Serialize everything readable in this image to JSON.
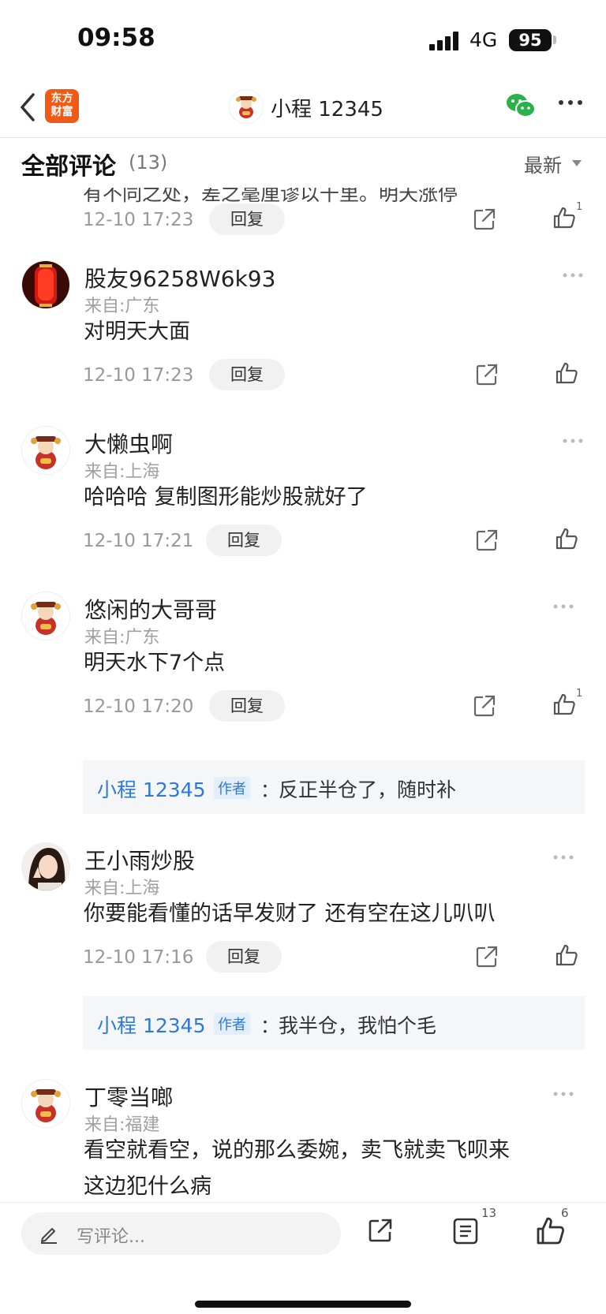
{
  "status": {
    "time": "09:58",
    "network": "4G",
    "battery": "95"
  },
  "nav": {
    "app_logo_line1": "东方",
    "app_logo_line2": "财富",
    "title": "小程 12345"
  },
  "header": {
    "title": "全部评论",
    "count": "(13)",
    "sort": "最新"
  },
  "partial_text": "有不同之处，差之毫厘谬以千里。明天涨停",
  "top_meta": {
    "time": "12-10 17:23",
    "reply": "回复",
    "likes": "1"
  },
  "comments": [
    {
      "user": "股友96258W6k93",
      "location": "来自:广东",
      "content": "对明天大面",
      "time": "12-10 17:23",
      "reply": "回复",
      "likes": ""
    },
    {
      "user": "大懒虫啊",
      "location": "来自:上海",
      "content": "哈哈哈  复制图形能炒股就好了",
      "time": "12-10 17:21",
      "reply": "回复",
      "likes": ""
    },
    {
      "user": "悠闲的大哥哥",
      "location": "来自:广东",
      "content": "明天水下7个点",
      "time": "12-10 17:20",
      "reply": "回复",
      "likes": "1",
      "sub_reply": {
        "name": "小程 12345",
        "tag": "作者",
        "colon": "：",
        "text": "反正半仓了，随时补"
      }
    },
    {
      "user": "王小雨炒股",
      "location": "来自:上海",
      "content": "你要能看懂的话早发财了 还有空在这儿叭叭",
      "time": "12-10 17:16",
      "reply": "回复",
      "likes": "",
      "sub_reply": {
        "name": "小程 12345",
        "tag": "作者",
        "colon": "：",
        "text": "我半仓，我怕个毛"
      }
    },
    {
      "user": "丁零当啷",
      "location": "来自:福建",
      "content_line1": "看空就看空，说的那么委婉，卖飞就卖飞呗来",
      "content_line2": "这边犯什么病"
    }
  ],
  "bottom": {
    "placeholder": "写评论...",
    "comment_count": "13",
    "like_count": "6"
  },
  "icons": [
    "back-icon",
    "wechat-icon",
    "more-icon",
    "share-icon",
    "thumb-up-icon",
    "pencil-icon",
    "list-icon",
    "dots-icon"
  ],
  "colors": {
    "brand": "#f05a14",
    "link": "#2c7ad6",
    "wechat": "#2ab14a"
  }
}
